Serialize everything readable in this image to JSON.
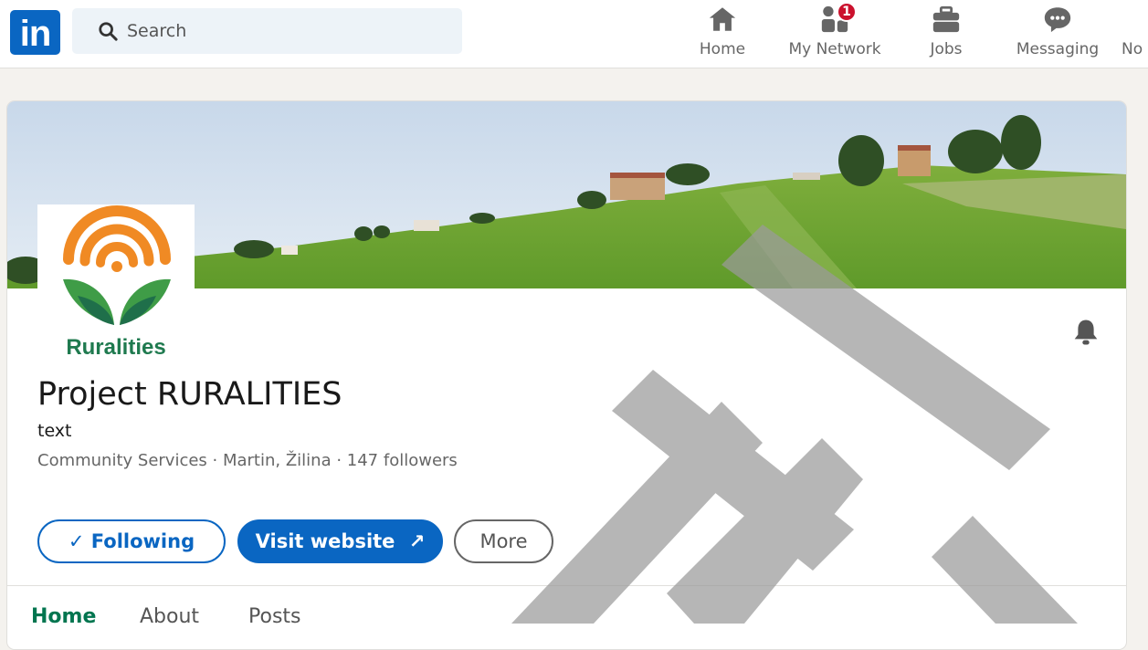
{
  "nav": {
    "logo": "in",
    "search_placeholder": "Search",
    "items": [
      {
        "label": "Home",
        "icon": "home-icon"
      },
      {
        "label": "My Network",
        "icon": "my-network-icon",
        "badge": "1"
      },
      {
        "label": "Jobs",
        "icon": "jobs-icon"
      },
      {
        "label": "Messaging",
        "icon": "messaging-icon"
      },
      {
        "label": "No",
        "icon": "notifications-icon"
      }
    ]
  },
  "profile": {
    "logo_text": "Ruralities",
    "name": "Project RURALITIES",
    "tagline": "text",
    "meta": "Community Services · Martin, Žilina · 147 followers",
    "buttons": {
      "following": "✓ Following",
      "visit": "Visit website",
      "visit_icon": "↗",
      "more": "More"
    },
    "tabs": [
      "Home",
      "About",
      "Posts"
    ]
  },
  "colors": {
    "brand": "#0a66c2",
    "badge": "#cb112d",
    "active_tab": "#01754f",
    "logo_orange": "#f08a24",
    "logo_green": "#3f9c47",
    "logo_dark_green": "#1f6f4a"
  }
}
